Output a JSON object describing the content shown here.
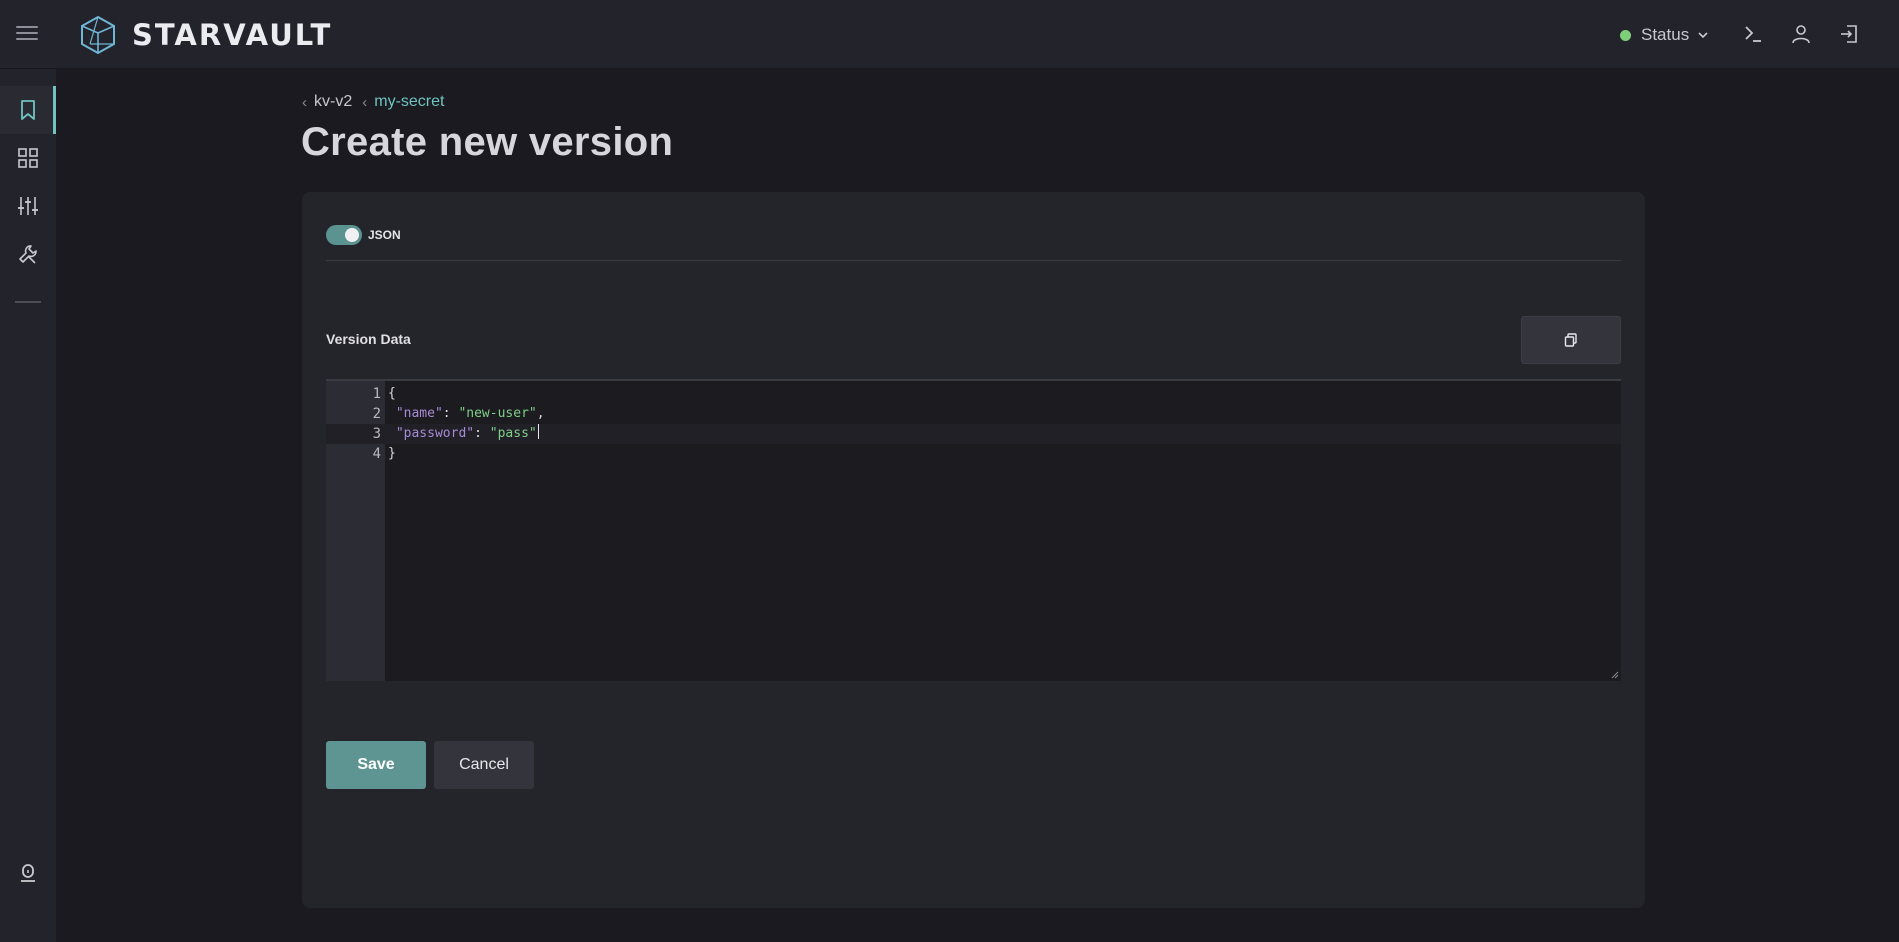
{
  "app": {
    "brand": "STARVAULT"
  },
  "header": {
    "status_label": "Status",
    "status_color": "#7fcf7a",
    "icons": [
      "menu-icon",
      "terminal-icon",
      "user-icon",
      "logout-icon"
    ]
  },
  "sidebar": {
    "items": [
      {
        "name": "bookmark-icon",
        "active": true
      },
      {
        "name": "grid-icon",
        "active": false
      },
      {
        "name": "sliders-icon",
        "active": false
      },
      {
        "name": "tools-icon",
        "active": false
      }
    ],
    "bottom_icon": "lock-icon"
  },
  "breadcrumb": [
    {
      "label": "kv-v2"
    },
    {
      "label": "my-secret"
    }
  ],
  "page": {
    "title": "Create new version"
  },
  "form": {
    "json_toggle_label": "JSON",
    "json_toggle_on": true,
    "field_label": "Version Data",
    "copy_icon": "copy-icon",
    "editor": {
      "line_numbers": [
        "1",
        "2",
        "3",
        "4"
      ],
      "lines": [
        {
          "open": "{"
        },
        {
          "key": "\"name\"",
          "sep": ": ",
          "value": "\"new-user\"",
          "trail": ","
        },
        {
          "key": "\"password\"",
          "sep": ": ",
          "value": "\"pass\"",
          "trail": ""
        },
        {
          "close": "}"
        }
      ]
    },
    "save_label": "Save",
    "cancel_label": "Cancel"
  },
  "colors": {
    "accent": "#6fc4c0",
    "save_button": "#5e9592",
    "json_key": "#a78bd6",
    "json_string": "#7fd08a"
  }
}
